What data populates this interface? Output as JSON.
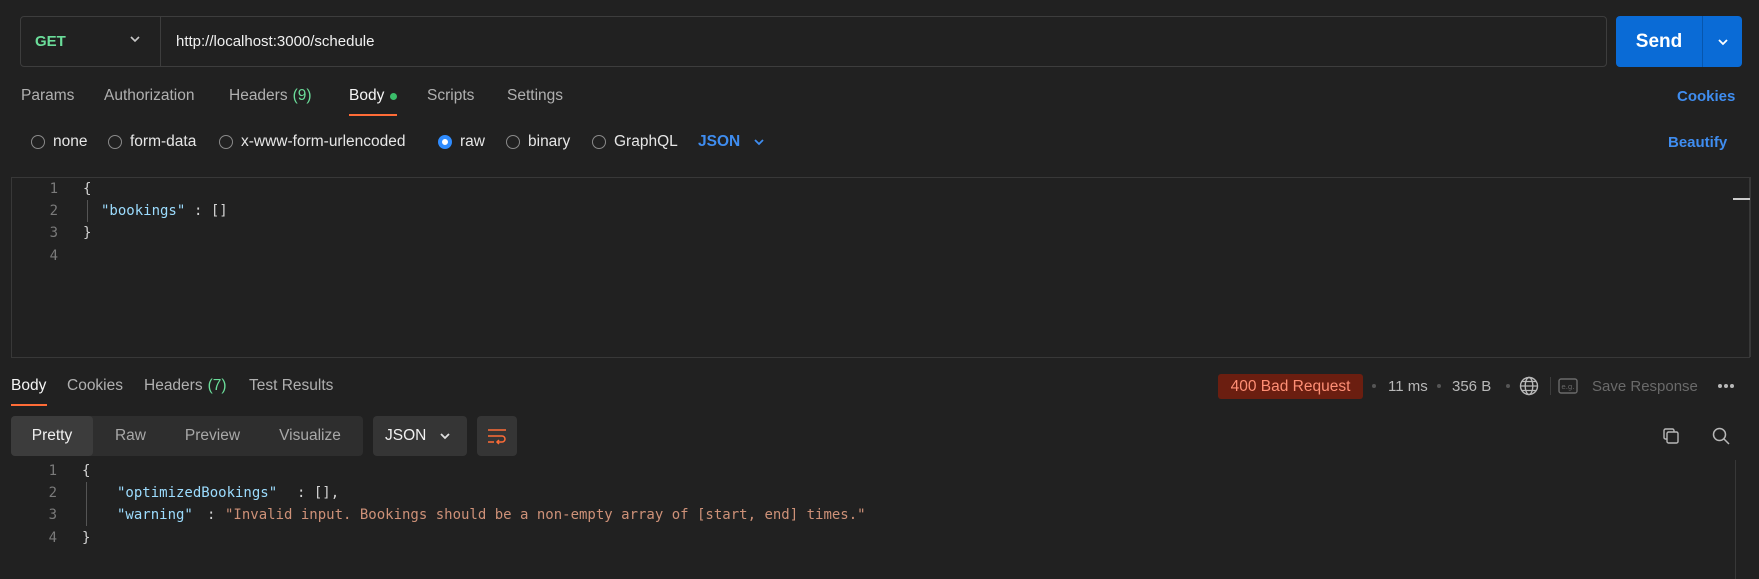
{
  "request": {
    "method": "GET",
    "url": "http://localhost:3000/schedule",
    "send_label": "Send"
  },
  "request_tabs": {
    "params": "Params",
    "authorization": "Authorization",
    "headers": "Headers",
    "headers_count": "(9)",
    "body": "Body",
    "scripts": "Scripts",
    "settings": "Settings",
    "cookies": "Cookies"
  },
  "body_types": {
    "none": "none",
    "form_data": "form-data",
    "urlencoded": "x-www-form-urlencoded",
    "raw": "raw",
    "binary": "binary",
    "graphql": "GraphQL",
    "selected": "raw",
    "language": "JSON",
    "beautify": "Beautify"
  },
  "request_body": {
    "line_numbers": [
      "1",
      "2",
      "3",
      "4"
    ],
    "open_brace": "{",
    "key": "\"bookings\"",
    "rest": ": []",
    "close_brace": "}"
  },
  "response_tabs": {
    "body": "Body",
    "cookies": "Cookies",
    "headers": "Headers",
    "headers_count": "(7)",
    "test_results": "Test Results"
  },
  "response_meta": {
    "status": "400 Bad Request",
    "time": "11 ms",
    "size": "356 B",
    "save_response": "Save Response",
    "status_color": "#ff8f75"
  },
  "response_view": {
    "pretty": "Pretty",
    "raw": "Raw",
    "preview": "Preview",
    "visualize": "Visualize",
    "format": "JSON"
  },
  "response_body": {
    "line_numbers": [
      "1",
      "2",
      "3",
      "4"
    ],
    "open_brace": "{",
    "key1": "\"optimizedBookings\"",
    "rest1": ": [],",
    "key2": "\"warning\"",
    "colon2": ": ",
    "value2": "\"Invalid input. Bookings should be a non-empty array of [start, end] times.\"",
    "close_brace": "}"
  },
  "colors": {
    "accent": "#ff6c37",
    "primary_button": "#0a6bd6",
    "link": "#3f8df0",
    "method_get": "#6bdd9a"
  }
}
